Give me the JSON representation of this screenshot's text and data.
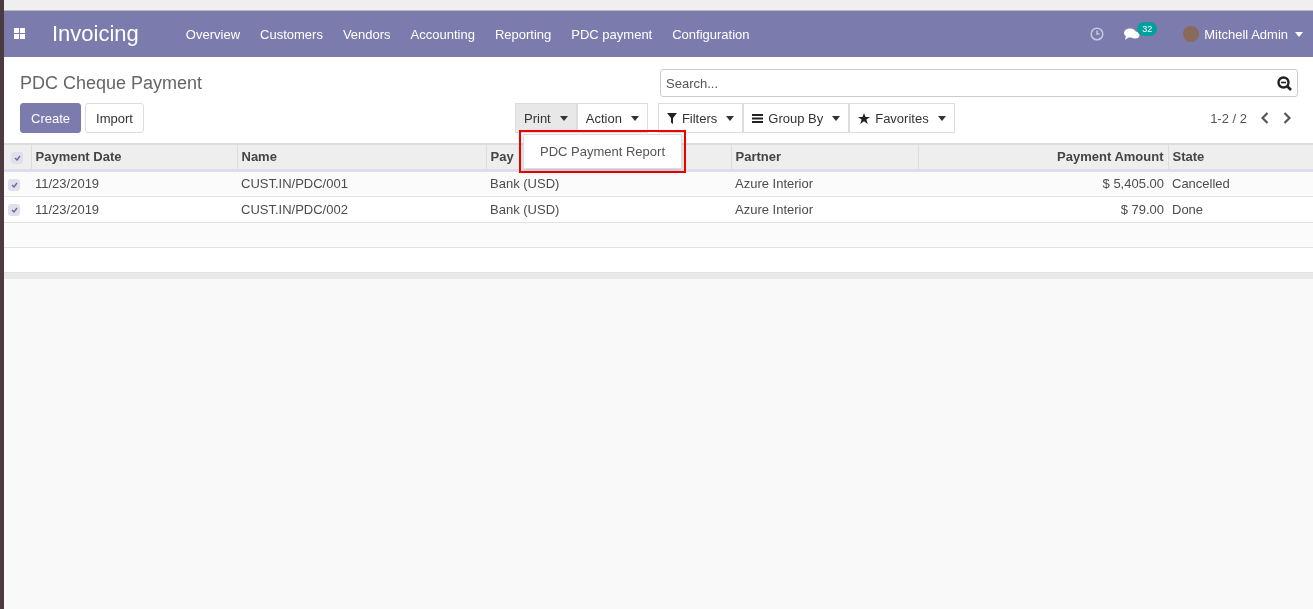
{
  "navbar": {
    "app_title": "Invoicing",
    "menu": [
      "Overview",
      "Customers",
      "Vendors",
      "Accounting",
      "Reporting",
      "PDC payment",
      "Configuration"
    ],
    "message_count": "32",
    "user": "Mitchell Admin"
  },
  "control_panel": {
    "title": "PDC Cheque Payment",
    "search": {
      "placeholder": "Search..."
    },
    "buttons": [
      {
        "label": "Create",
        "kind": "primary"
      },
      {
        "label": "Import",
        "kind": "secondary"
      }
    ],
    "action_menus": [
      {
        "label": "Print",
        "open": true
      },
      {
        "label": "Action",
        "open": false
      }
    ],
    "search_options": [
      {
        "label": "Filters",
        "kind": "filter"
      },
      {
        "label": "Group By",
        "kind": "group"
      },
      {
        "label": "Favorites",
        "kind": "favorite"
      }
    ],
    "pager": "1-2 / 2",
    "print_menu": {
      "items": [
        "PDC Payment Report"
      ],
      "highlighted": true
    }
  },
  "table": {
    "all_checked": true,
    "columns": [
      "Payment Date",
      "Name",
      "Pay",
      "Partner",
      "Payment Amount",
      "State"
    ],
    "rows": [
      {
        "checked": true,
        "cells": [
          "11/23/2019",
          "CUST.IN/PDC/001",
          "Bank (USD)",
          "Azure Interior",
          "$ 5,405.00",
          "Cancelled"
        ]
      },
      {
        "checked": true,
        "cells": [
          "11/23/2019",
          "CUST.IN/PDC/002",
          "Bank (USD)",
          "Azure Interior",
          "$ 79.00",
          "Done"
        ]
      }
    ]
  }
}
